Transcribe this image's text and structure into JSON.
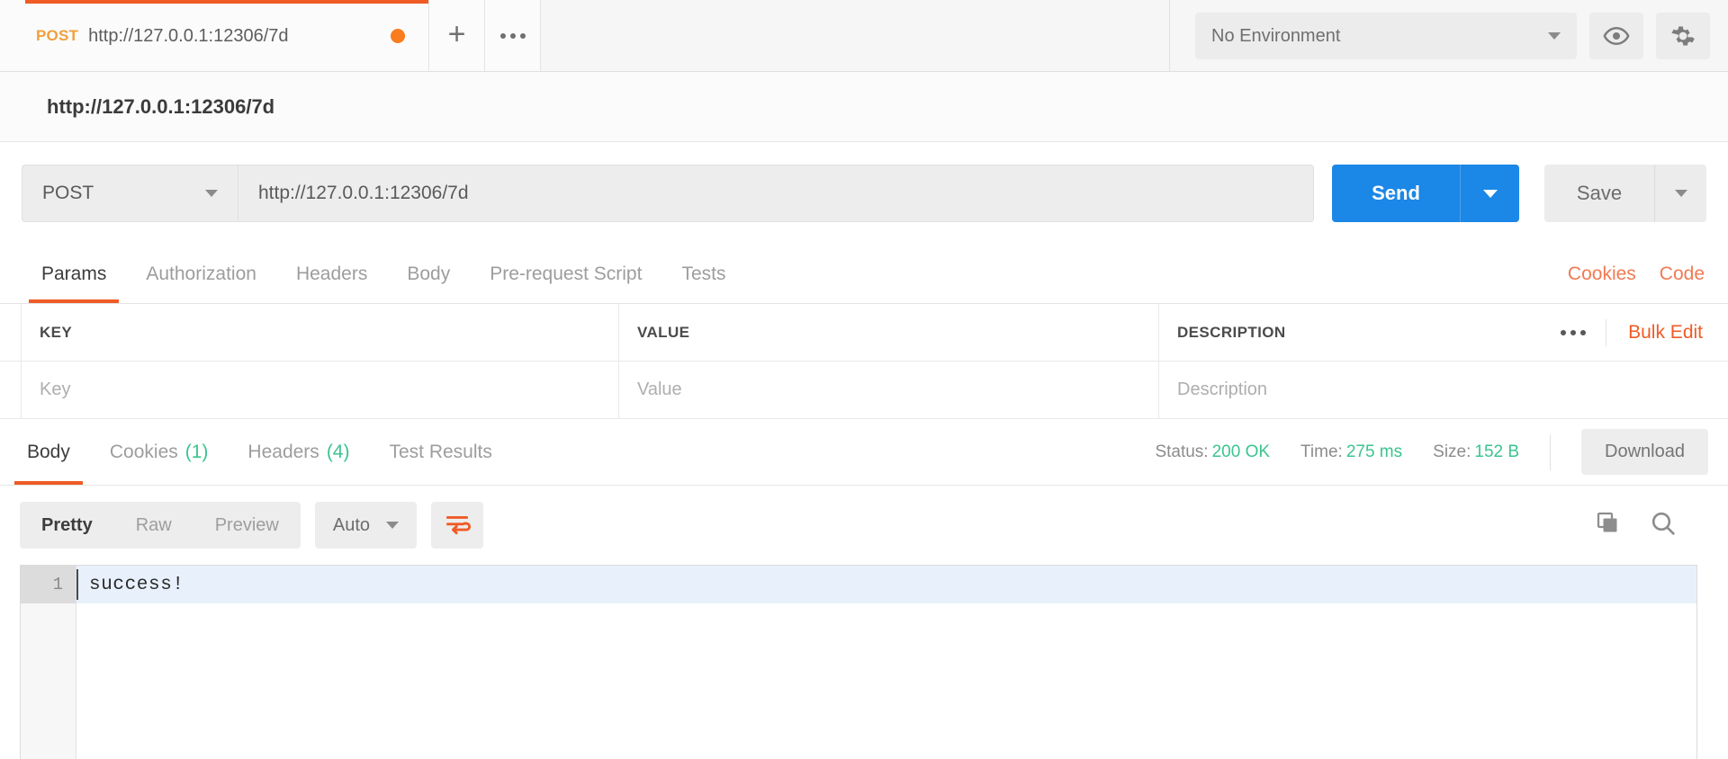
{
  "tab": {
    "method": "POST",
    "name": "http://127.0.0.1:12306/7d",
    "new_tab_label": "+",
    "options_label": "•••"
  },
  "environment": {
    "selected": "No Environment",
    "eye_title": "Environment quick look",
    "gear_title": "Settings"
  },
  "request": {
    "title": "http://127.0.0.1:12306/7d",
    "method": "POST",
    "url": "http://127.0.0.1:12306/7d",
    "send_label": "Send",
    "save_label": "Save"
  },
  "request_tabs": {
    "items": [
      {
        "label": "Params",
        "active": true
      },
      {
        "label": "Authorization",
        "active": false
      },
      {
        "label": "Headers",
        "active": false
      },
      {
        "label": "Body",
        "active": false
      },
      {
        "label": "Pre-request Script",
        "active": false
      },
      {
        "label": "Tests",
        "active": false
      }
    ],
    "cookies_link": "Cookies",
    "code_link": "Code"
  },
  "params_table": {
    "headers": {
      "key": "KEY",
      "value": "VALUE",
      "description": "DESCRIPTION"
    },
    "bulk_edit": "Bulk Edit",
    "rows": [
      {
        "key_placeholder": "Key",
        "value_placeholder": "Value",
        "description_placeholder": "Description"
      }
    ]
  },
  "response_tabs": {
    "items": [
      {
        "label": "Body",
        "count": "",
        "active": true
      },
      {
        "label": "Cookies",
        "count": "(1)",
        "active": false
      },
      {
        "label": "Headers",
        "count": "(4)",
        "active": false
      },
      {
        "label": "Test Results",
        "count": "",
        "active": false
      }
    ]
  },
  "response_status": {
    "status_label": "Status:",
    "status_value": "200 OK",
    "time_label": "Time:",
    "time_value": "275 ms",
    "size_label": "Size:",
    "size_value": "152 B",
    "download_label": "Download"
  },
  "body_toolbar": {
    "views": [
      {
        "label": "Pretty",
        "active": true
      },
      {
        "label": "Raw",
        "active": false
      },
      {
        "label": "Preview",
        "active": false
      }
    ],
    "format": "Auto",
    "wrap_icon": "word-wrap-icon",
    "copy_icon": "copy-icon",
    "search_icon": "search-icon"
  },
  "response_body": {
    "lines": [
      {
        "number": "1",
        "text": "success!"
      }
    ]
  },
  "colors": {
    "accent_orange": "#ef5b25",
    "send_blue": "#1b87e6",
    "status_green": "#3bc48f",
    "method_post": "#f0a03c"
  }
}
